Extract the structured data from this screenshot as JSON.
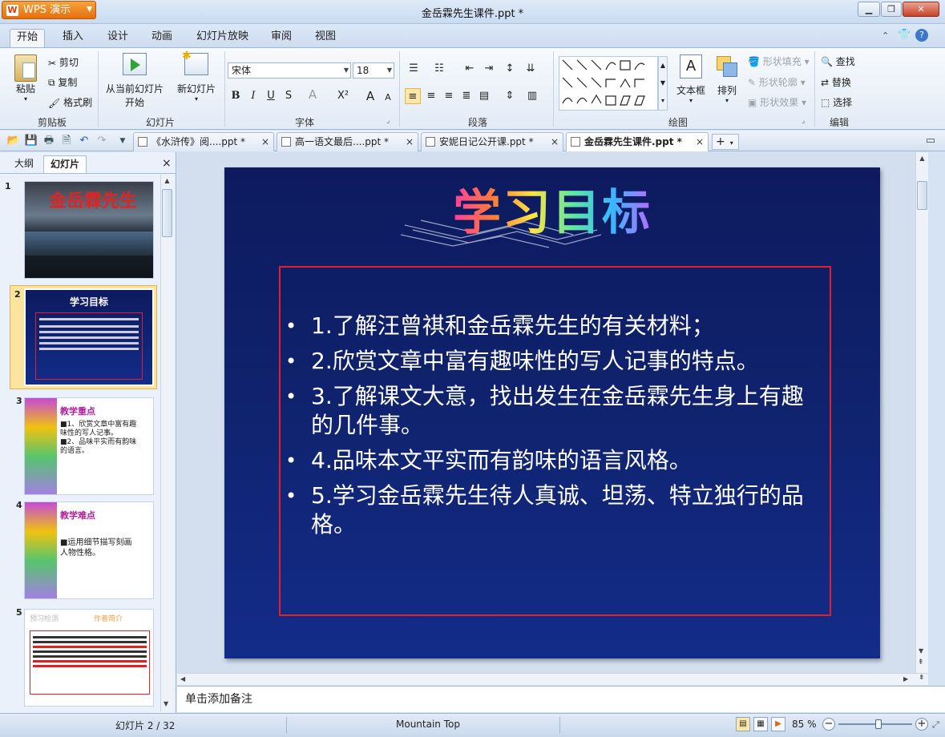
{
  "app": {
    "name": "WPS 演示",
    "logo": "W",
    "window_title": "金岳霖先生课件.ppt *"
  },
  "menu": {
    "tabs": [
      "开始",
      "插入",
      "设计",
      "动画",
      "幻灯片放映",
      "审阅",
      "视图"
    ],
    "active": "开始"
  },
  "ribbon": {
    "clipboard": {
      "paste": "粘贴",
      "cut": "剪切",
      "copy": "复制",
      "format_painter": "格式刷",
      "label": "剪贴板"
    },
    "slides": {
      "from_current": "从当前幻灯片",
      "start": "开始",
      "new_slide": "新幻灯片",
      "label": "幻灯片"
    },
    "font": {
      "name": "宋体",
      "size": "18",
      "label": "字体",
      "bold": "B",
      "italic": "I",
      "underline": "U",
      "shadow": "S",
      "color": "A",
      "super": "X²",
      "grow": "A",
      "shrink": "A"
    },
    "paragraph": {
      "label": "段落"
    },
    "drawing": {
      "textbox": "文本框",
      "arrange": "排列",
      "fill": "形状填充",
      "outline": "形状轮廓",
      "effect": "形状效果",
      "label": "绘图"
    },
    "editing": {
      "find": "查找",
      "replace": "替换",
      "select": "选择",
      "label": "编辑"
    }
  },
  "doc_tabs": [
    {
      "title": "《水浒传》阅....ppt *",
      "active": false
    },
    {
      "title": "高一语文最后....ppt *",
      "active": false
    },
    {
      "title": "安妮日记公开课.ppt *",
      "active": false
    },
    {
      "title": "金岳霖先生课件.ppt *",
      "active": true
    }
  ],
  "left_panel": {
    "tabs": [
      "大纲",
      "幻灯片"
    ],
    "active": "幻灯片",
    "close": "×",
    "thumbs": [
      {
        "num": "1",
        "title": "金岳霖先生"
      },
      {
        "num": "2",
        "title": "学习目标"
      },
      {
        "num": "3",
        "heading": "教学重点",
        "lines": [
          "■1、欣赏文章中富有趣",
          "味性的写人记事。",
          "■2、品味平实而有韵味",
          "的语言。"
        ]
      },
      {
        "num": "4",
        "heading": "教学难点",
        "lines": [
          "■运用细节描写刻画",
          "人物性格。"
        ]
      },
      {
        "num": "5",
        "heading": "预习检测",
        "extra": "作者简介"
      }
    ]
  },
  "slide": {
    "title": "学习目标",
    "bullets": [
      "1.了解汪曾祺和金岳霖先生的有关材料；",
      "2.欣赏文章中富有趣味性的写人记事的特点。",
      "3.了解课文大意，找出发生在金岳霖先生身上有趣的几件事。",
      "4.品味本文平实而有韵味的语言风格。",
      "5.学习金岳霖先生待人真诚、坦荡、特立独行的品格。"
    ]
  },
  "notes": {
    "placeholder": "单击添加备注"
  },
  "status": {
    "slide_info": "幻灯片 2 / 32",
    "theme": "Mountain Top",
    "zoom": "85 %",
    "zoom_level": 0.55
  },
  "colors": {
    "accent": "#e46f0e",
    "slide_bg": "#10236f",
    "box_border": "#e0202a"
  }
}
